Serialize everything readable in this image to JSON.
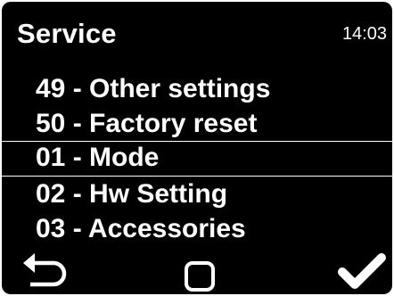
{
  "header": {
    "title": "Service",
    "time": "14:03"
  },
  "menu": {
    "items": [
      {
        "label": "49 - Other settings",
        "selected": false
      },
      {
        "label": "50 - Factory reset",
        "selected": false
      },
      {
        "label": "01 - Mode",
        "selected": true
      },
      {
        "label": "02 - Hw Setting",
        "selected": false
      },
      {
        "label": "03 - Accessories",
        "selected": false
      }
    ]
  },
  "softkeys": {
    "left_icon": "back-arrow-icon",
    "center_icon": "home-square-icon",
    "right_icon": "checkmark-icon"
  },
  "colors": {
    "background": "#000000",
    "foreground": "#ffffff",
    "bezel": "#ffffff"
  }
}
